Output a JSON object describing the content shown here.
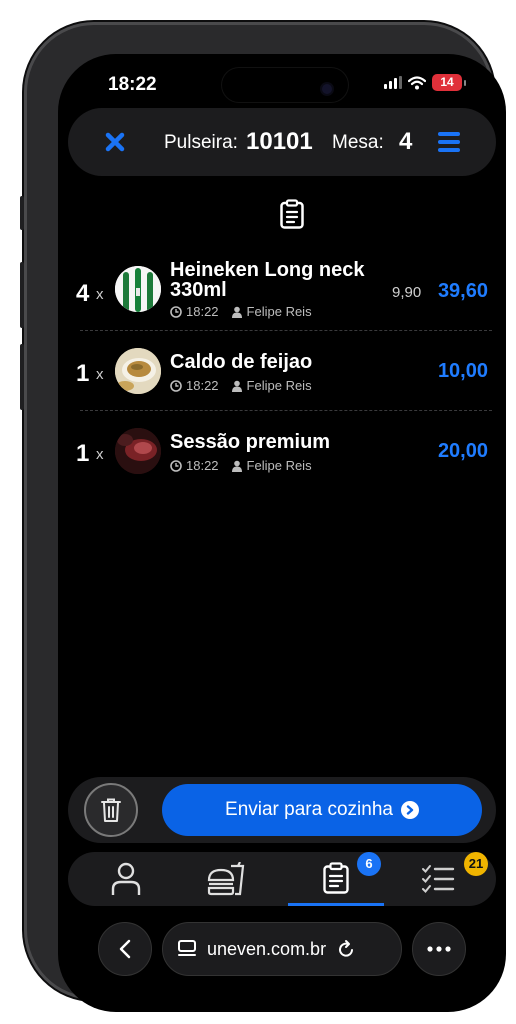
{
  "status_bar": {
    "time": "18:22",
    "battery": "14"
  },
  "header": {
    "pulseira_label": "Pulseira:",
    "pulseira_value": "10101",
    "mesa_label": "Mesa:",
    "mesa_value": "4"
  },
  "order": {
    "items": [
      {
        "qty": "4",
        "x": "x",
        "name": "Heineken Long neck 330ml",
        "time": "18:22",
        "user": "Felipe Reis",
        "unit_price": "9,90",
        "total": "39,60"
      },
      {
        "qty": "1",
        "x": "x",
        "name": "Caldo de feijao",
        "time": "18:22",
        "user": "Felipe Reis",
        "unit_price": "",
        "total": "10,00"
      },
      {
        "qty": "1",
        "x": "x",
        "name": "Sessão premium",
        "time": "18:22",
        "user": "Felipe Reis",
        "unit_price": "",
        "total": "20,00"
      }
    ]
  },
  "actions": {
    "send_label": "Enviar para cozinha"
  },
  "tabs": {
    "order_badge": "6",
    "checklist_badge": "21"
  },
  "browser": {
    "url": "uneven.com.br"
  },
  "colors": {
    "accent": "#1a73f5",
    "price": "#1f7cff",
    "badge_blue": "#1a73f5",
    "badge_yellow": "#f0b400"
  }
}
